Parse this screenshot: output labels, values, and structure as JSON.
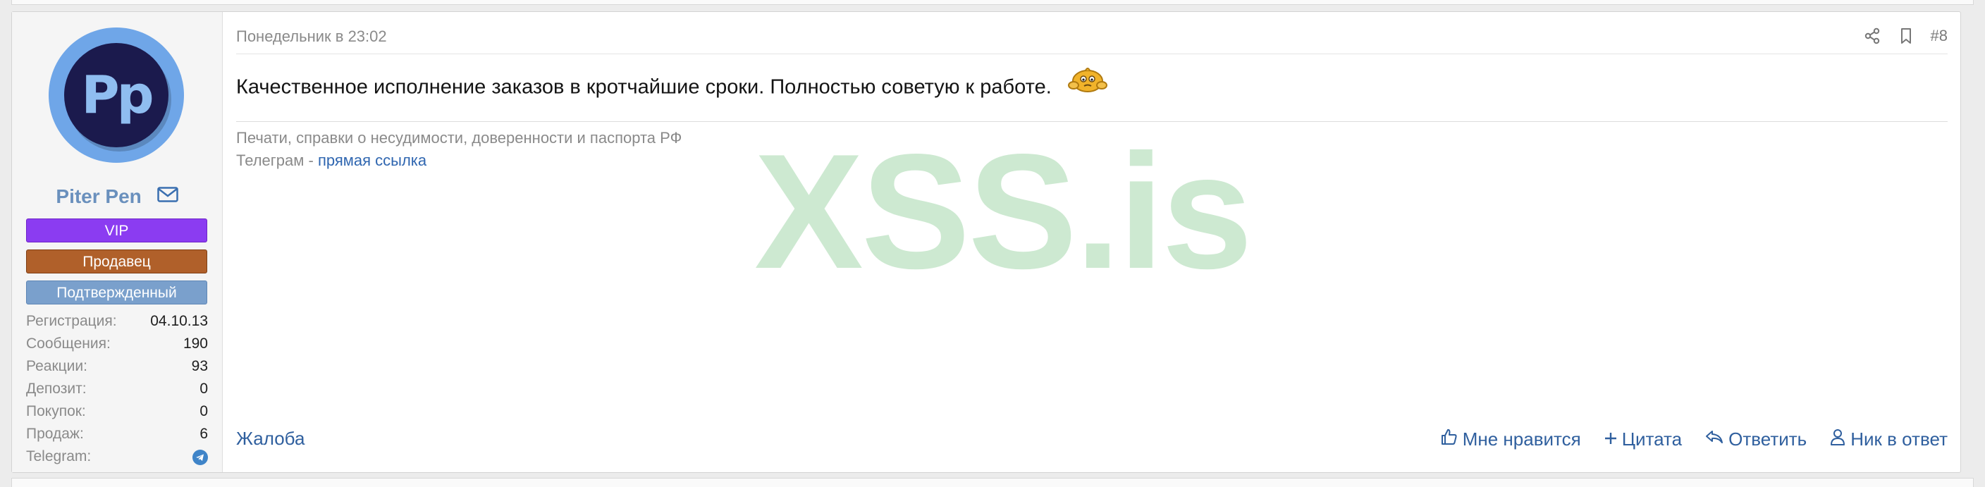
{
  "post": {
    "date": "Понедельник в 23:02",
    "number": "#8",
    "message": "Качественное исполнение заказов в кротчайшие сроки. Полностью советую к работе.",
    "signature": {
      "line1": "Печати, справки о несудимости, доверенности и паспорта РФ",
      "line2_prefix": "Телеграм - ",
      "line2_link": "прямая ссылка"
    },
    "watermark": "XSS.is",
    "report_label": "Жалоба",
    "actions": {
      "like": "Мне нравится",
      "quote": "Цитата",
      "reply": "Ответить",
      "nick_reply": "Ник в ответ"
    }
  },
  "user": {
    "avatar_letters": "Pp",
    "name": "Piter Pen",
    "badges": {
      "vip": "VIP",
      "seller": "Продавец",
      "verified": "Подтвержденный"
    },
    "stats": [
      {
        "label": "Регистрация:",
        "value": "04.10.13"
      },
      {
        "label": "Сообщения:",
        "value": "190"
      },
      {
        "label": "Реакции:",
        "value": "93"
      },
      {
        "label": "Депозит:",
        "value": "0"
      },
      {
        "label": "Покупок:",
        "value": "0"
      },
      {
        "label": "Продаж:",
        "value": "6"
      },
      {
        "label": "Telegram:",
        "value": ""
      }
    ]
  },
  "colors": {
    "vip": "#8b3cf1",
    "seller": "#b0602a",
    "verified": "#7aa0cc",
    "link": "#2f5f9e",
    "watermark": "#cde9d1"
  },
  "icons": {
    "mail": "envelope-icon",
    "share": "share-icon",
    "bookmark": "bookmark-icon",
    "like": "thumbs-up-icon",
    "quote": "plus-icon",
    "reply": "reply-icon",
    "nick": "user-icon",
    "telegram": "telegram-icon",
    "emoji": "emoji-icon"
  }
}
